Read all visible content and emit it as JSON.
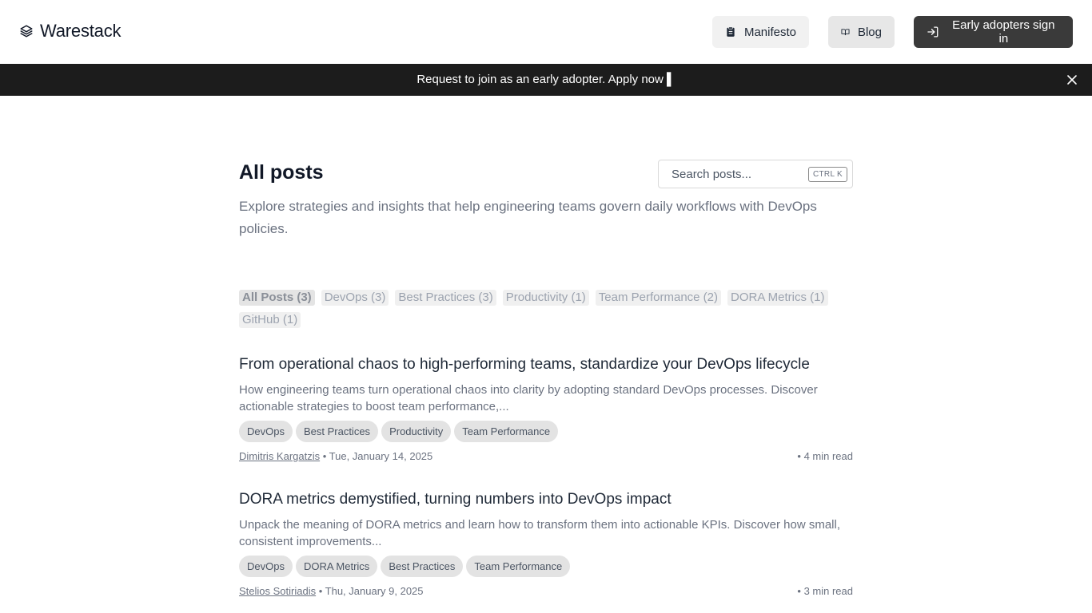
{
  "header": {
    "brand": "Warestack",
    "nav": {
      "manifesto_label": "Manifesto",
      "blog_label": "Blog",
      "signin_label": "Early adopters sign in"
    }
  },
  "banner": {
    "text": "Request to join as an early adopter. Apply now ",
    "link_glyph": "▌"
  },
  "main": {
    "title": "All posts",
    "subtitle": "Explore strategies and insights that help engineering teams govern daily workflows with DevOps policies.",
    "search": {
      "placeholder": "Search posts...",
      "shortcut": "CTRL K"
    },
    "filters": [
      {
        "label": "All Posts (3)",
        "active": true
      },
      {
        "label": "DevOps (3)"
      },
      {
        "label": "Best Practices (3)"
      },
      {
        "label": "Productivity (1)"
      },
      {
        "label": "Team Performance (2)"
      },
      {
        "label": "DORA Metrics (1)"
      },
      {
        "label": "GitHub (1)"
      }
    ]
  },
  "posts": [
    {
      "title": "From operational chaos to high-performing teams, standardize your DevOps lifecycle",
      "excerpt": "How engineering teams turn operational chaos into clarity by adopting standard DevOps processes. Discover actionable strategies to boost team performance,...",
      "tags": [
        "DevOps",
        "Best Practices",
        "Productivity",
        "Team Performance"
      ],
      "author": "Dimitris Kargatzis",
      "date": " • Tue, January 14, 2025",
      "read_time": "• 4 min read"
    },
    {
      "title": "DORA metrics demystified, turning numbers into DevOps impact",
      "excerpt": "Unpack the meaning of DORA metrics and learn how to transform them into actionable KPIs. Discover how small, consistent improvements...",
      "tags": [
        "DevOps",
        "DORA Metrics",
        "Best Practices",
        "Team Performance"
      ],
      "author": "Stelios Sotiriadis",
      "date": " • Thu, January 9, 2025",
      "read_time": "• 3 min read"
    }
  ],
  "icons": {
    "logo": "layers-icon",
    "manifesto": "clipboard-icon",
    "blog": "book-open-icon",
    "signin": "log-in-icon",
    "close": "close-icon"
  }
}
